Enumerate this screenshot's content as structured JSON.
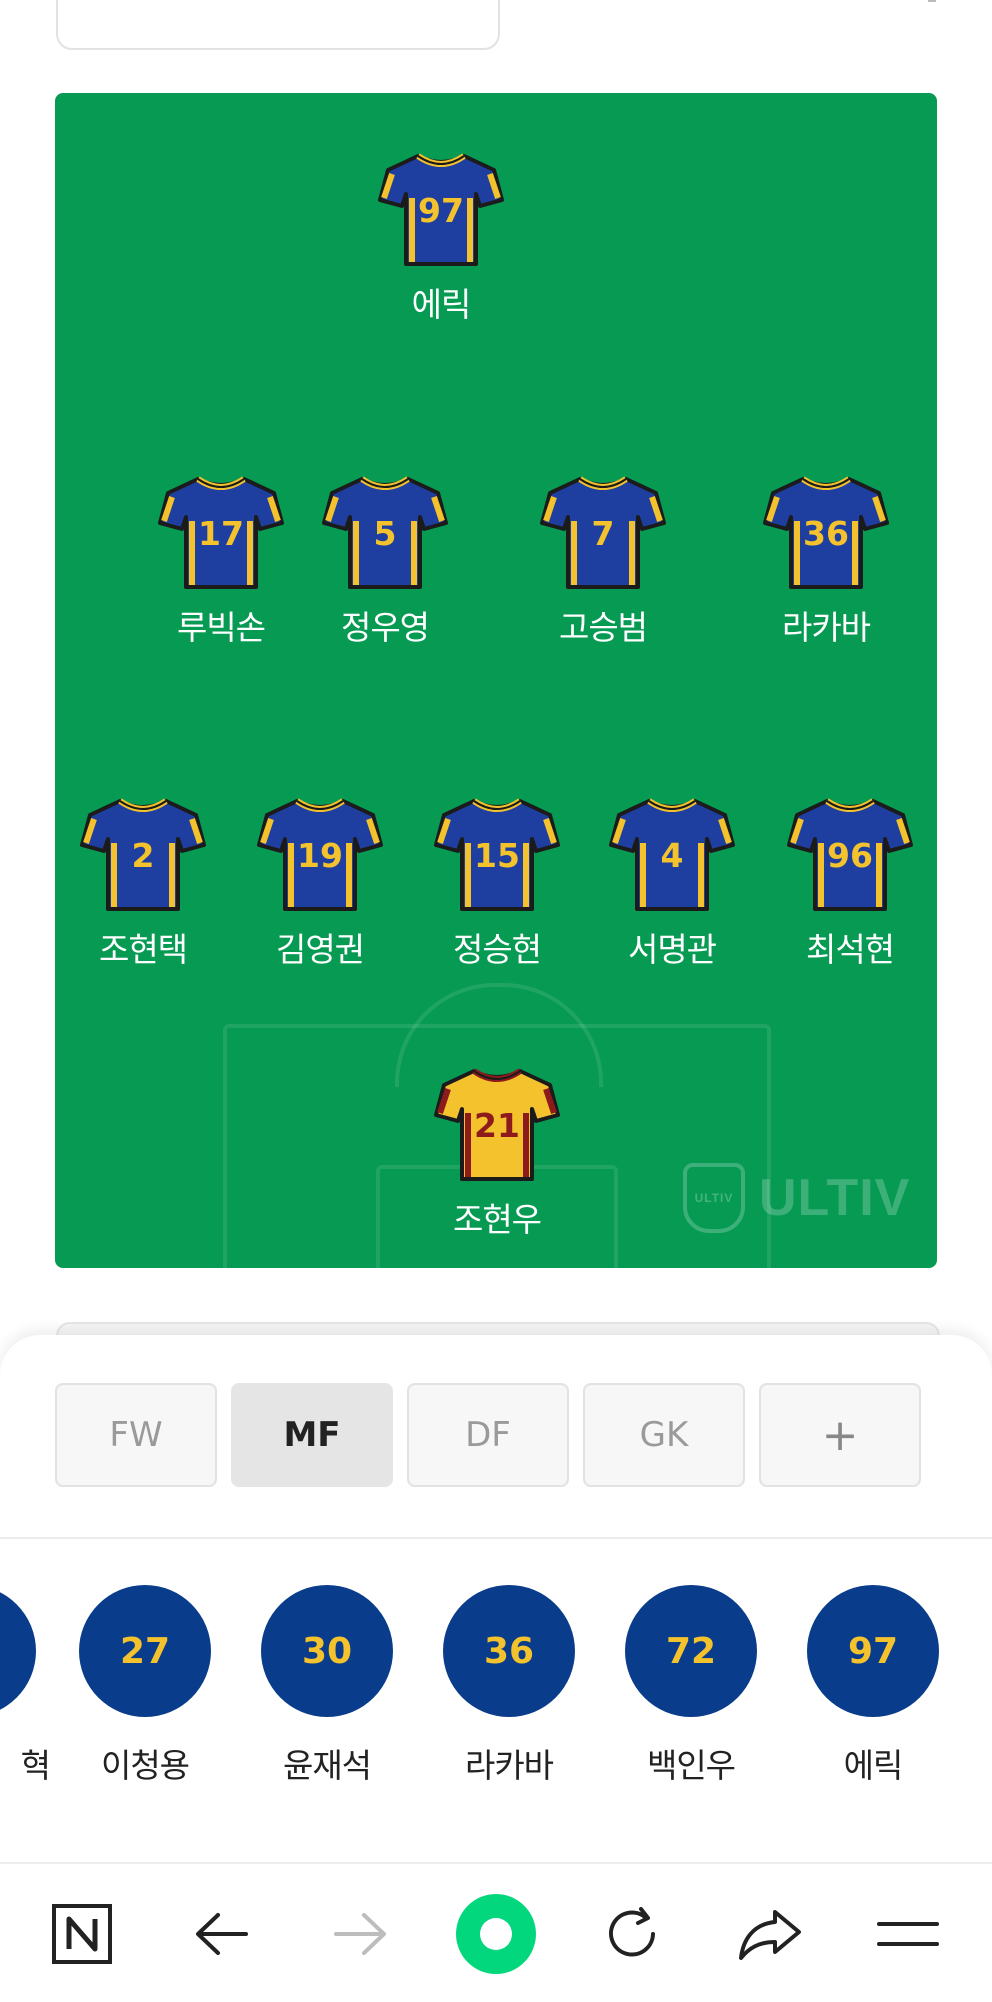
{
  "field": {
    "logo_text": "ULTIV",
    "players": [
      {
        "number": "97",
        "name": "에릭",
        "kit": "home"
      },
      {
        "number": "17",
        "name": "루빅손",
        "kit": "home"
      },
      {
        "number": "5",
        "name": "정우영",
        "kit": "home"
      },
      {
        "number": "7",
        "name": "고승범",
        "kit": "home"
      },
      {
        "number": "36",
        "name": "라카바",
        "kit": "home"
      },
      {
        "number": "2",
        "name": "조현택",
        "kit": "home"
      },
      {
        "number": "19",
        "name": "김영권",
        "kit": "home"
      },
      {
        "number": "15",
        "name": "정승현",
        "kit": "home"
      },
      {
        "number": "4",
        "name": "서명관",
        "kit": "home"
      },
      {
        "number": "96",
        "name": "최석현",
        "kit": "home"
      },
      {
        "number": "21",
        "name": "조현우",
        "kit": "goalkeeper"
      }
    ]
  },
  "position_tabs": [
    {
      "label": "FW",
      "active": false
    },
    {
      "label": "MF",
      "active": true
    },
    {
      "label": "DF",
      "active": false
    },
    {
      "label": "GK",
      "active": false
    },
    {
      "label": "+",
      "active": false
    }
  ],
  "roster": [
    {
      "number": "",
      "name": "혁"
    },
    {
      "number": "27",
      "name": "이청용"
    },
    {
      "number": "30",
      "name": "윤재석"
    },
    {
      "number": "36",
      "name": "라카바"
    },
    {
      "number": "72",
      "name": "백인우"
    },
    {
      "number": "97",
      "name": "에릭"
    }
  ],
  "colors": {
    "field": "#069a53",
    "home_kit": "#1f3fa0",
    "home_trim": "#f3c22c",
    "gk_kit": "#f3c22c",
    "gk_trim": "#8e1b1b",
    "roster_circle": "#0a3c8c",
    "nav_accent": "#03d77e"
  },
  "nav": {
    "icons": [
      "naver-n-icon",
      "back-arrow-icon",
      "forward-arrow-icon",
      "green-dot-icon",
      "reload-icon",
      "share-icon",
      "menu-icon"
    ]
  }
}
